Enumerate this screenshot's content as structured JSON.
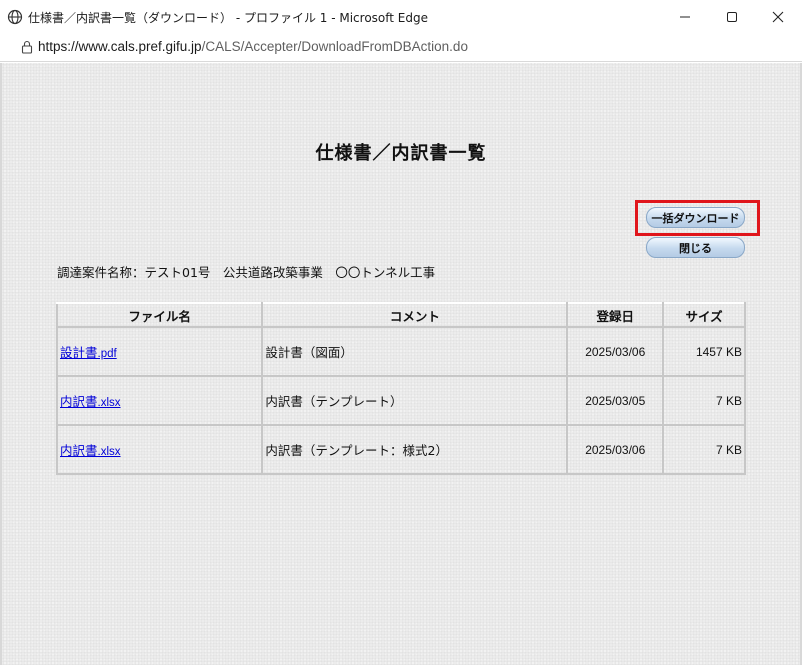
{
  "window": {
    "title": "仕様書／内訳書一覧（ダウンロード） - プロファイル 1 - Microsoft Edge",
    "url_host": "https://www.cals.pref.gifu.jp",
    "url_path": "/CALS/Accepter/DownloadFromDBAction.do"
  },
  "page": {
    "title": "仕様書／内訳書一覧",
    "bulk_download_label": "一括ダウンロード",
    "close_label": "閉じる",
    "project_label": "調達案件名称：",
    "project_name": "テスト01号　公共道路改築事業　〇〇トンネル工事"
  },
  "table": {
    "headers": [
      "ファイル名",
      "コメント",
      "登録日",
      "サイズ"
    ],
    "rows": [
      {
        "name": "設計書",
        "ext": ".pdf",
        "comment": "設計書（図面）",
        "date": "2025/03/06",
        "size": "1457 KB"
      },
      {
        "name": "内訳書",
        "ext": ".xlsx",
        "comment": "内訳書（テンプレート）",
        "date": "2025/03/05",
        "size": "7 KB"
      },
      {
        "name": "内訳書",
        "ext": ".xlsx",
        "comment": "内訳書（テンプレート：様式2）",
        "date": "2025/03/06",
        "size": "7 KB"
      }
    ]
  },
  "icons": {
    "globe": "globe-icon",
    "lock": "lock-icon",
    "minimize": "minimize-icon",
    "maximize": "maximize-icon",
    "close": "close-icon"
  },
  "colors": {
    "highlight": "#e0151b",
    "link": "#0000d8"
  }
}
